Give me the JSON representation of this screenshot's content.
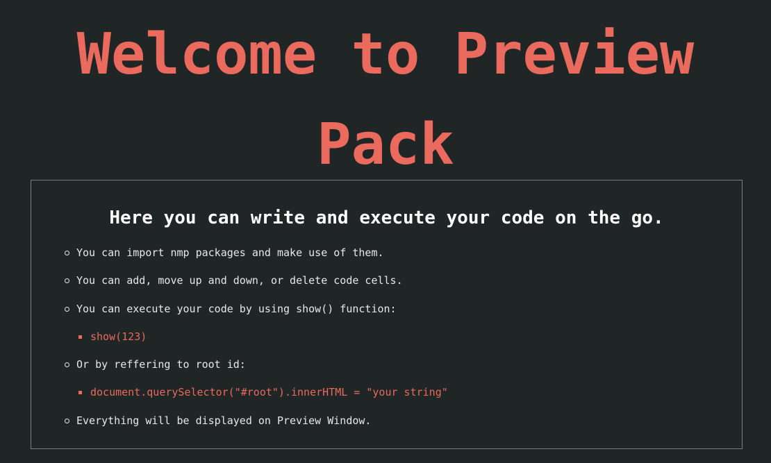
{
  "header": {
    "title_line1": "Welcome to Preview",
    "title_line2": "Pack"
  },
  "panel": {
    "heading": "Here you can write and execute your code on the go.",
    "items": [
      {
        "kind": "text",
        "text": "You can import nmp packages and make use of them."
      },
      {
        "kind": "text",
        "text": "You can add, move up and down, or delete code cells."
      },
      {
        "kind": "text",
        "text": "You can execute your code by using show() function:"
      },
      {
        "kind": "code",
        "text": "show(123)"
      },
      {
        "kind": "text",
        "text": "Or by reffering to root id:"
      },
      {
        "kind": "code",
        "text": "document.querySelector(\"#root\").innerHTML = \"your string\""
      },
      {
        "kind": "text",
        "text": "Everything will be displayed on Preview Window."
      }
    ]
  },
  "colors": {
    "background": "#202526",
    "accent": "#ea6a5d",
    "heading": "#ffffff",
    "text": "#e8e8e8",
    "border": "#7a7e7f"
  }
}
